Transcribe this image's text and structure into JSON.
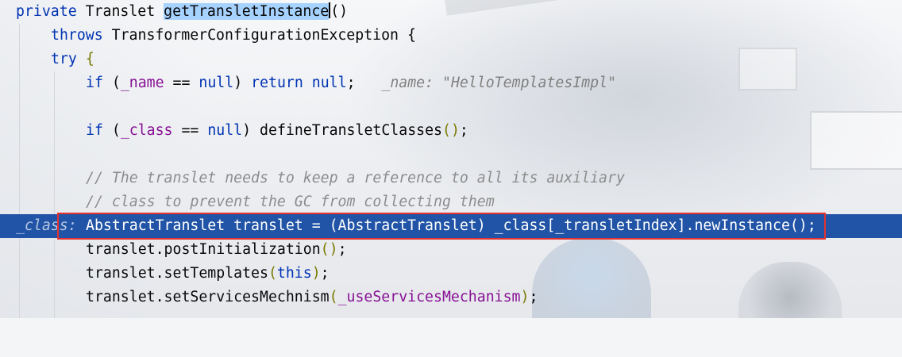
{
  "colors": {
    "keyword": "#0033b3",
    "field": "#871094",
    "comment": "#8c8c8c",
    "current_line": "#2154a6",
    "highlight_box": "#e3322f",
    "selection": "#a6d2ff"
  },
  "code": {
    "l1": {
      "kw_private": "private",
      "type": "Translet",
      "method": "getTransletInstance",
      "parens": "()"
    },
    "l2": {
      "kw_throws": "throws",
      "exception": "TransformerConfigurationException",
      "brace": "{"
    },
    "l3": {
      "kw_try": "try",
      "brace": "{"
    },
    "l4": {
      "kw_if": "if",
      "lparen": "(",
      "field": "_name",
      "op": " == ",
      "null1": "null",
      "rparen": ")",
      "kw_return": "return",
      "null2": "null",
      "semi": ";",
      "hint": "_name: \"HelloTemplatesImpl\""
    },
    "l5": {
      "kw_if": "if",
      "lparen": "(",
      "field": "_class",
      "op": " == ",
      "null1": "null",
      "rparen": ")",
      "call": "defineTransletClasses",
      "parens": "()",
      "semi": ";"
    },
    "l6": {
      "comment": "// The translet needs to keep a reference to all its auxiliary"
    },
    "l7": {
      "comment": "// class to prevent the GC from collecting them"
    },
    "l8": {
      "text": "AbstractTranslet translet = (AbstractTranslet) _class[_transletIndex].newInstance();",
      "hint": "_class:"
    },
    "l9": {
      "text": "translet.postInitialization",
      "parens": "()",
      "semi": ";"
    },
    "l10": {
      "text": "translet.setTemplates",
      "lparen": "(",
      "kw_this": "this",
      "rparen": ")",
      "semi": ";"
    },
    "l11": {
      "text": "translet.setServicesMechnism",
      "lparen": "(",
      "field": "_useServicesMechanism",
      "rparen": ")",
      "semi": ";"
    }
  }
}
